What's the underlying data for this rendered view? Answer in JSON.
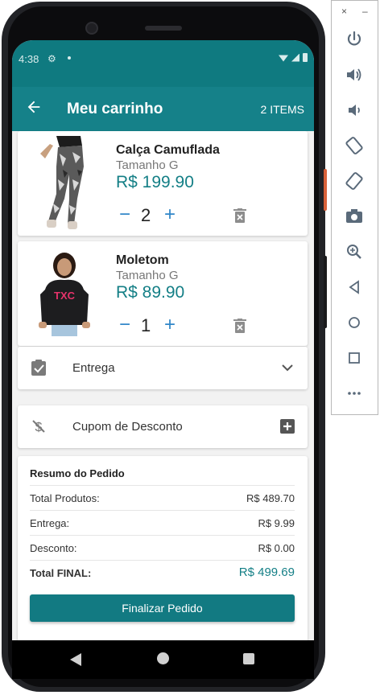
{
  "status_bar": {
    "time": "4:38"
  },
  "app_bar": {
    "title": "Meu carrinho",
    "items_count": "2 ITEMS"
  },
  "products": [
    {
      "name": "Calça Camuflada",
      "size": "Tamanho G",
      "price": "R$ 199.90",
      "quantity": "2"
    },
    {
      "name": "Moletom",
      "size": "Tamanho G",
      "price": "R$ 89.90",
      "quantity": "1"
    }
  ],
  "quantity_controls": {
    "minus": "−",
    "plus": "+"
  },
  "delivery": {
    "label": "Entrega"
  },
  "coupon": {
    "label": "Cupom de Desconto"
  },
  "summary": {
    "title": "Resumo do Pedido",
    "rows": [
      {
        "label": "Total Produtos:",
        "value": "R$ 489.70"
      },
      {
        "label": "Entrega:",
        "value": "R$ 9.99"
      },
      {
        "label": "Desconto:",
        "value": "R$ 0.00"
      },
      {
        "label": "Total FINAL:",
        "value": "R$ 499.69"
      }
    ],
    "button": "Finalizar Pedido"
  },
  "colors": {
    "primary": "#158189",
    "status_bar": "#0f7a80",
    "price": "#147f86",
    "qty_controls": "#2f86c8",
    "button": "#127a82"
  },
  "icons": {
    "back": "arrow-back-icon",
    "trash": "trash-icon",
    "delivery": "clipboard-check-icon",
    "delivery_toggle": "chevron-down-icon",
    "coupon": "money-off-icon",
    "coupon_add": "add-box-icon"
  },
  "emulator_toolbar": {
    "close": "×",
    "minimize": "–",
    "buttons": [
      "power-icon",
      "volume-up-icon",
      "volume-down-icon",
      "rotate-left-icon",
      "rotate-right-icon",
      "camera-icon",
      "zoom-icon",
      "back-icon",
      "home-icon",
      "overview-icon",
      "more-icon"
    ]
  }
}
